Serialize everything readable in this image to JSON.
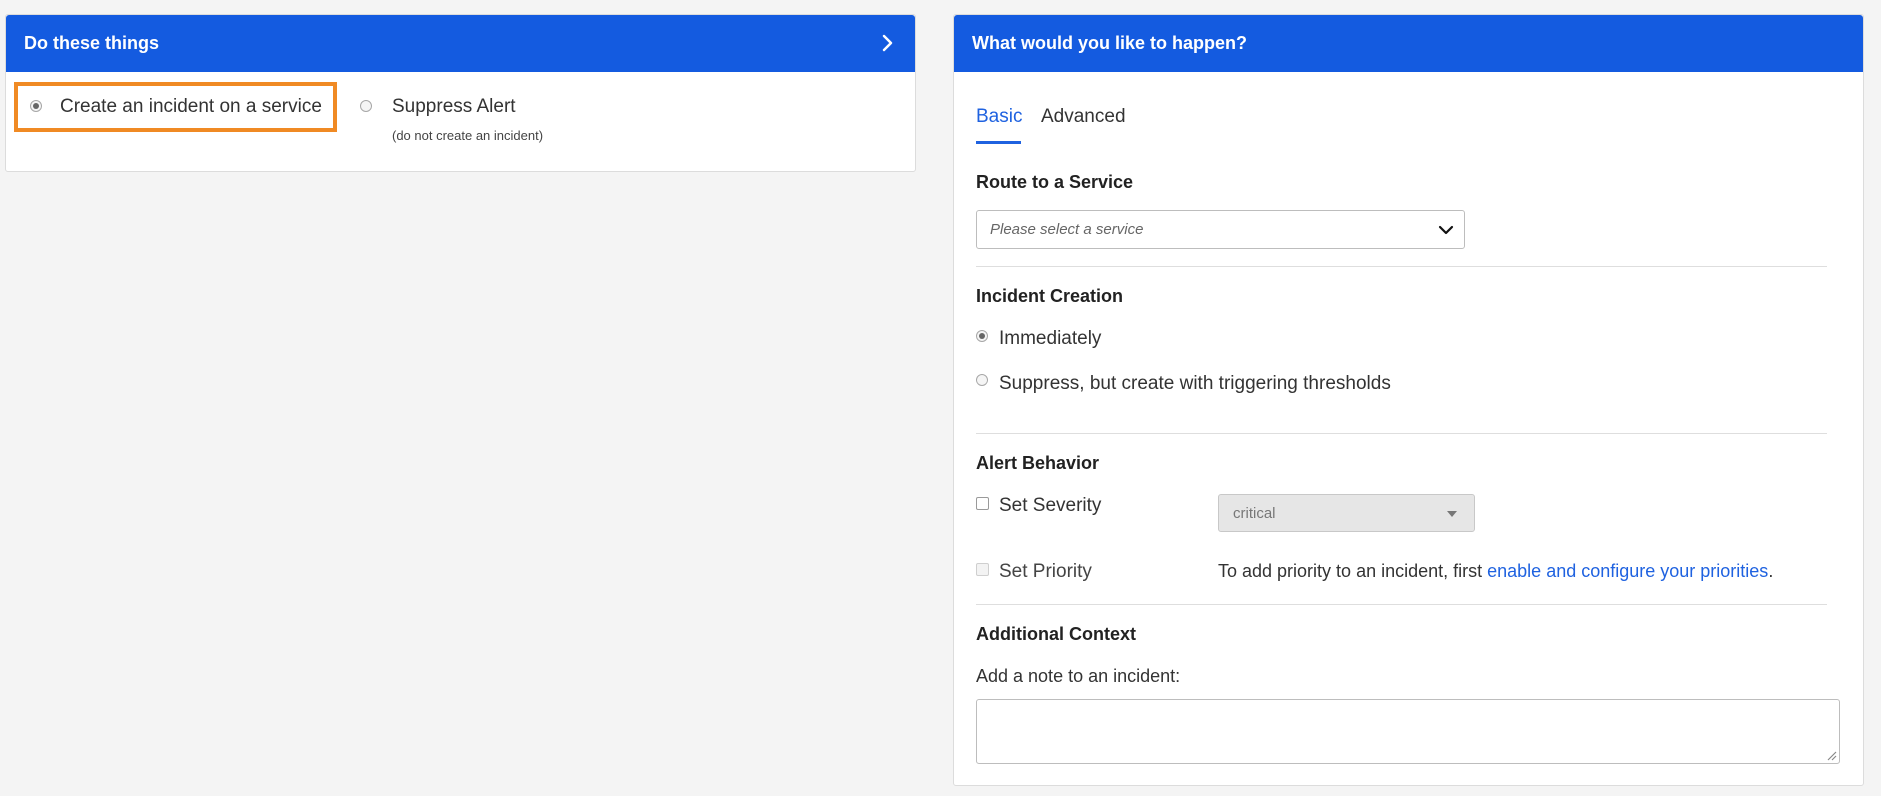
{
  "left_panel": {
    "title": "Do these things",
    "options": [
      {
        "label": "Create an incident on a service",
        "selected": true
      },
      {
        "label": "Suppress Alert",
        "sublabel": "(do not create an incident)",
        "selected": false
      }
    ]
  },
  "right_panel": {
    "title": "What would you like to happen?",
    "tabs": [
      {
        "label": "Basic",
        "active": true
      },
      {
        "label": "Advanced",
        "active": false
      }
    ],
    "route": {
      "title": "Route to a Service",
      "placeholder": "Please select a service"
    },
    "incident_creation": {
      "title": "Incident Creation",
      "options": [
        {
          "label": "Immediately",
          "selected": true
        },
        {
          "label": "Suppress, but create with triggering thresholds",
          "selected": false
        }
      ]
    },
    "alert_behavior": {
      "title": "Alert Behavior",
      "set_severity": {
        "label": "Set Severity",
        "value": "critical"
      },
      "set_priority": {
        "label": "Set Priority",
        "text": "To add priority to an incident, first ",
        "link": "enable and configure your priorities",
        "suffix": "."
      }
    },
    "additional_context": {
      "title": "Additional Context",
      "note_label": "Add a note to an incident:"
    }
  },
  "colors": {
    "header_blue": "#145be0",
    "accent_blue": "#1f62e0",
    "highlight_orange": "#f08a24",
    "background": "#f4f4f4"
  }
}
